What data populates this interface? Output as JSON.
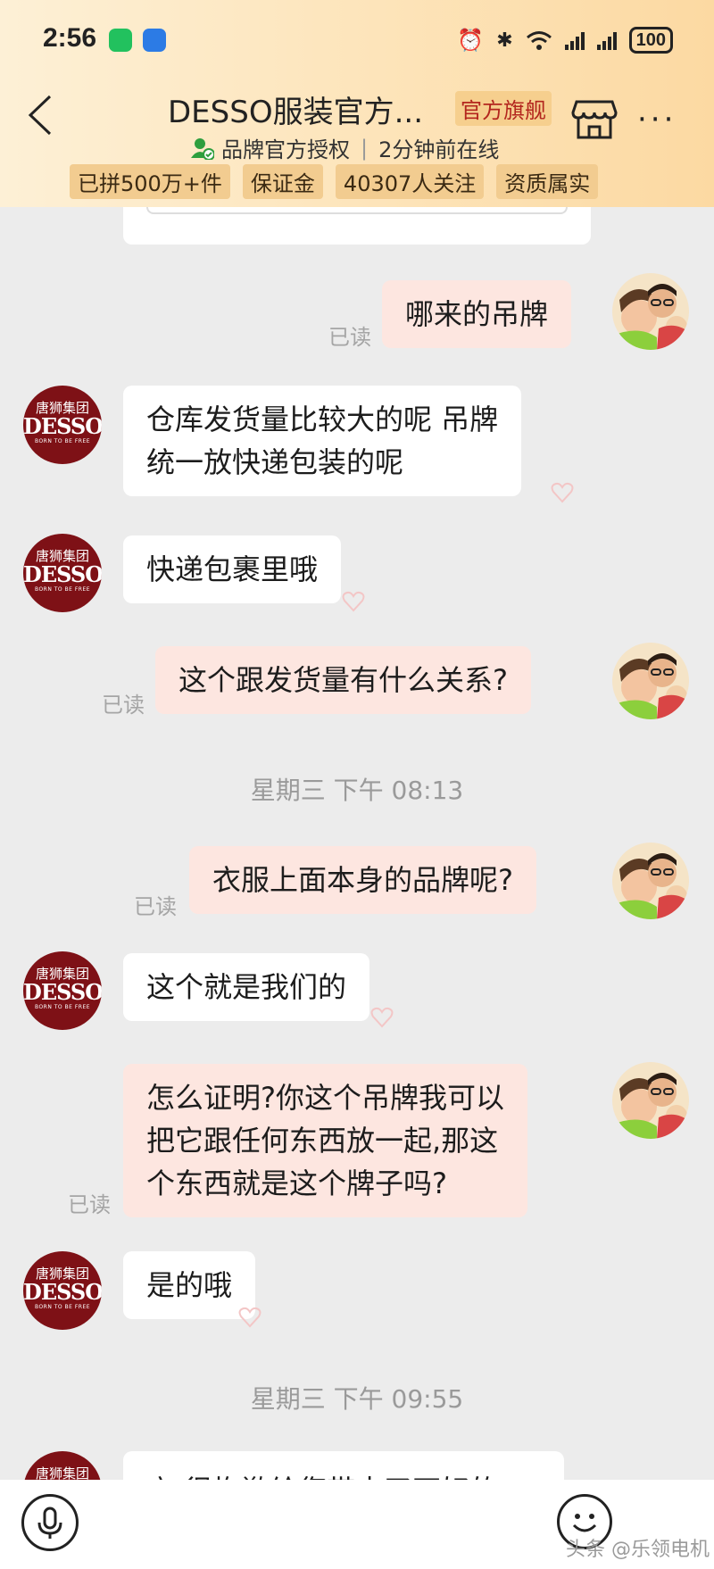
{
  "status_bar": {
    "time": "2:56",
    "battery": "100"
  },
  "header": {
    "shop_name": "DESSO服装官方...",
    "official_badge": "官方旗舰",
    "auth_label": "品牌官方授权",
    "online_status": "2分钟前在线",
    "tags": [
      "已拼500万+件",
      "保证金",
      "40307人关注",
      "资质属实"
    ]
  },
  "avatar_logo": {
    "cn": "唐狮集团",
    "en": "DESSO",
    "tagline": "BORN TO BE FREE"
  },
  "read_label": "已读",
  "messages": [
    {
      "side": "out",
      "text": "哪来的吊牌"
    },
    {
      "side": "in",
      "lines": [
        "仓库发货量比较大的呢 吊牌",
        "统一放快递包装的呢"
      ]
    },
    {
      "side": "in",
      "text": "快递包裹里哦"
    },
    {
      "side": "out",
      "text": "这个跟发货量有什么关系?"
    },
    {
      "side": "out",
      "text": "衣服上面本身的品牌呢?"
    },
    {
      "side": "in",
      "text": "这个就是我们的"
    },
    {
      "side": "out",
      "lines": [
        "怎么证明?你这个吊牌我可以",
        "把它跟任何东西放一起,那这",
        "个东西就是这个牌子吗?"
      ]
    },
    {
      "side": "in",
      "text": "是的哦"
    },
    {
      "side": "in",
      "text": "亲,很抱歉给您带来了不好的"
    }
  ],
  "time_separators": [
    "星期三 下午 08:13",
    "星期三 下午 09:55"
  ],
  "watermark": "头条 @乐领电机",
  "colors": {
    "header_start": "#fdf0d6",
    "header_end": "#fcd9a2",
    "out_bubble": "#fde6e0",
    "in_bubble": "#ffffff",
    "brand_red": "#7e1116"
  }
}
